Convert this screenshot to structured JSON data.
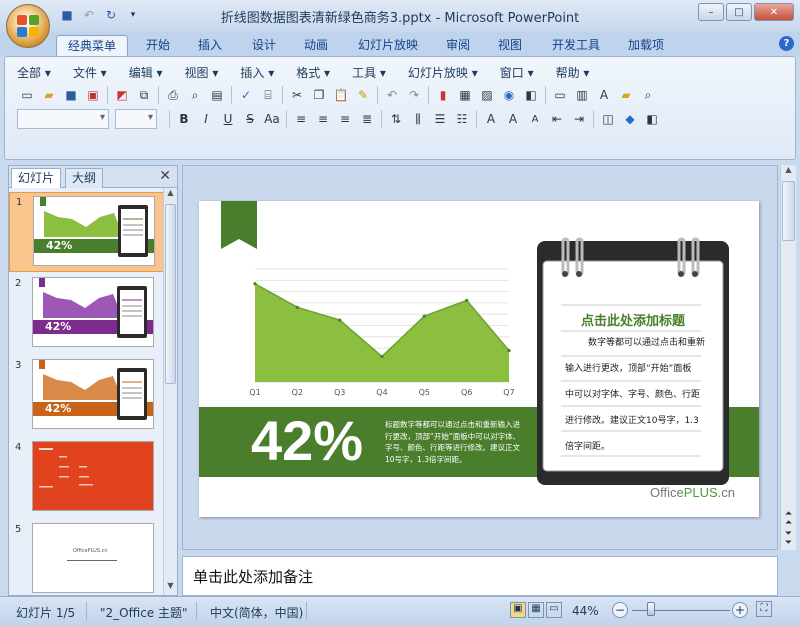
{
  "window": {
    "title": "折线图数据图表清新绿色商务3.pptx - Microsoft PowerPoint",
    "controls": [
      "–",
      "□",
      "✕"
    ]
  },
  "qat": [
    {
      "icon": "save-icon",
      "glyph": "💾"
    },
    {
      "icon": "undo-icon",
      "glyph": "↶"
    },
    {
      "icon": "redo-icon",
      "glyph": "↷"
    },
    {
      "icon": "customize-icon",
      "glyph": "▾"
    }
  ],
  "tabs": [
    "经典菜单",
    "开始",
    "插入",
    "设计",
    "动画",
    "幻灯片放映",
    "审阅",
    "视图",
    "开发工具",
    "加载项"
  ],
  "menu": [
    "全部 ▾",
    "文件 ▾",
    "编辑 ▾",
    "视图 ▾",
    "插入 ▾",
    "格式 ▾",
    "工具 ▾",
    "幻灯片放映 ▾",
    "窗口 ▾",
    "帮助 ▾"
  ],
  "help": "?",
  "pane": {
    "tab_slides": "幻灯片",
    "tab_outline": "大纲",
    "close": "✕"
  },
  "thumbs": [
    {
      "num": "1",
      "pct": "42%",
      "color": "#4a7d2c"
    },
    {
      "num": "2",
      "pct": "42%",
      "color": "#7b2c8c"
    },
    {
      "num": "3",
      "pct": "42%",
      "color": "#c86418"
    },
    {
      "num": "4",
      "color": "#e2431f"
    },
    {
      "num": "5",
      "brand": "OfficePLUS.cn"
    }
  ],
  "slide": {
    "pct": "42%",
    "desc": "标题数字等都可以通过点击和重新输入进行更改，顶部“开始”面板中可以对字体、字号、颜色、行距等进行修改。建议正文10号字，1.3倍字间距。",
    "note_title": "点击此处添加标题",
    "note_lines": [
      "数字等都可以通过点击和重新",
      "输入进行更改，顶部“开始”面板",
      "中可以对字体、字号、颜色、行距",
      "进行修改。建议正文10号字，1.3",
      "倍字间距。"
    ],
    "brand_a": "Office",
    "brand_b": "PLUS",
    "brand_c": ".cn",
    "colors": {
      "green": "#4a7d2c",
      "area": "#8cbf3f",
      "dark": "#2b2b2b"
    }
  },
  "chart_data": {
    "type": "area",
    "categories": [
      "Q1",
      "Q2",
      "Q3",
      "Q4",
      "Q5",
      "Q6",
      "Q7"
    ],
    "values": [
      100,
      76,
      63,
      26,
      67,
      83,
      32
    ],
    "ylim": [
      0,
      115
    ]
  },
  "notes": "单击此处添加备注",
  "status": {
    "slide": "幻灯片 1/5",
    "theme": "\"2_Office 主题\"",
    "lang": "中文(简体，中国)",
    "zoom": "44%",
    "zoom_level": 0.44
  }
}
